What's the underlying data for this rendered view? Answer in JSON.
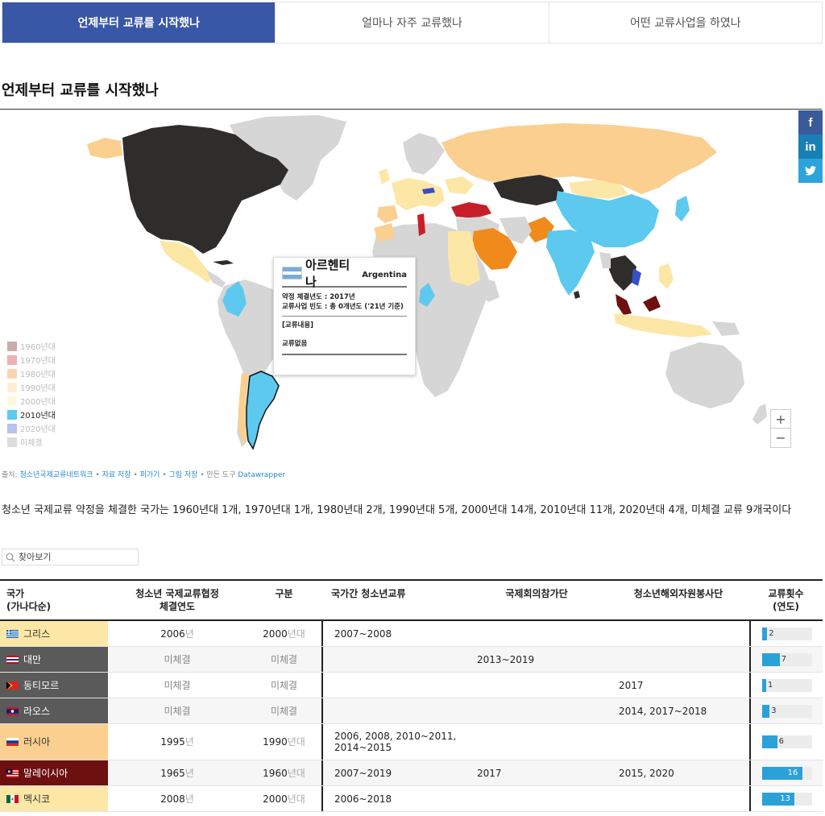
{
  "tabs": [
    {
      "label": "언제부터 교류를 시작했나",
      "active": true
    },
    {
      "label": "얼마나 자주 교류했나",
      "active": false
    },
    {
      "label": "어떤 교류사업을 하였나",
      "active": false
    }
  ],
  "section_title": "언제부터 교류를 시작했나",
  "colors": {
    "tab_active": "#3957a7",
    "decade_1960": "#6e0f10",
    "decade_1970": "#c71f29",
    "decade_1980": "#f08a1b",
    "decade_1990": "#fbcf8f",
    "decade_2000": "#fde7a6",
    "decade_2010": "#5dc9ee",
    "decade_2020": "#3750c4",
    "none": "#d6d6d6",
    "older": "#2e2d2b",
    "bar": "#2aa1d7"
  },
  "legend": [
    {
      "label": "1960년대",
      "color": "#6e0f10",
      "active": false
    },
    {
      "label": "1970년대",
      "color": "#c71f29",
      "active": false
    },
    {
      "label": "1980년대",
      "color": "#f08a1b",
      "active": false
    },
    {
      "label": "1990년대",
      "color": "#fbcf8f",
      "active": false
    },
    {
      "label": "2000년대",
      "color": "#fde7a6",
      "active": false
    },
    {
      "label": "2010년대",
      "color": "#5dc9ee",
      "active": true
    },
    {
      "label": "2020년대",
      "color": "#3750c4",
      "active": false
    },
    {
      "label": "미체결",
      "color": "#d6d6d6",
      "active": false
    }
  ],
  "social": {
    "facebook": "f",
    "linkedin": "in",
    "twitter": "twitter-icon"
  },
  "zoom": {
    "in": "+",
    "out": "−"
  },
  "tooltip": {
    "name_ko": "아르헨티나",
    "name_en": "Argentina",
    "line1": "약정 체결년도 : 2017년",
    "line2": "교류사업 빈도 : 총 0개년도 ('21년 기준)",
    "content_label": "[교류내용]",
    "content_value": "교류없음"
  },
  "credits": {
    "prefix": "출처: ",
    "source": "청소년국제교류네트워크",
    "sep1": " • ",
    "save_data": "자료 저장",
    "sep2": " • ",
    "embed": "퍼가기",
    "sep3": " • ",
    "save_image": "그림 저장",
    "tool_prefix": " • 만든 도구 ",
    "tool": "Datawrapper"
  },
  "summary": "청소년 국제교류 약정을 체결한 국가는 1960년대 1개, 1970년대 1개, 1980년대 2개, 1990년대 5개, 2000년대 14개, 2010년대 11개, 2020년대 4개, 미체결 교류 9개국이다",
  "search": {
    "placeholder": "찾아보기"
  },
  "table": {
    "headers": {
      "country_l1": "국가",
      "country_l2": "(가나다순)",
      "agreement_l1": "청소년 국제교류협정",
      "agreement_l2": "체결연도",
      "category": "구분",
      "bilateral": "국가간 청소년교류",
      "conference": "국제회의참가단",
      "volunteer": "청소년해외자원봉사단",
      "count_l1": "교류횟수",
      "count_l2": "(연도)"
    },
    "rows": [
      {
        "country": "그리스",
        "bg": "#fde7a6",
        "text": "#333",
        "flag": "greece",
        "year": "2006",
        "year_unit": "년",
        "cat": "2000",
        "cat_unit": "년대",
        "bilateral": "2007~2008",
        "conference": "",
        "volunteer": "",
        "count": 2,
        "count_label": "2"
      },
      {
        "country": "대만",
        "bg": "#5a5a5a",
        "text": "#fff",
        "flag": "taiwan",
        "year": "미체결",
        "year_unit": "",
        "cat": "미체결",
        "cat_unit": "",
        "bilateral": "",
        "conference": "2013~2019",
        "volunteer": "",
        "count": 7,
        "count_label": "7"
      },
      {
        "country": "동티모르",
        "bg": "#5a5a5a",
        "text": "#fff",
        "flag": "timor",
        "year": "미체결",
        "year_unit": "",
        "cat": "미체결",
        "cat_unit": "",
        "bilateral": "",
        "conference": "",
        "volunteer": "2017",
        "count": 1,
        "count_label": "1"
      },
      {
        "country": "라오스",
        "bg": "#5a5a5a",
        "text": "#fff",
        "flag": "laos",
        "year": "미체결",
        "year_unit": "",
        "cat": "미체결",
        "cat_unit": "",
        "bilateral": "",
        "conference": "",
        "volunteer": "2014, 2017~2018",
        "count": 3,
        "count_label": "3"
      },
      {
        "country": "러시아",
        "bg": "#fbcf8f",
        "text": "#333",
        "flag": "russia",
        "year": "1995",
        "year_unit": "년",
        "cat": "1990",
        "cat_unit": "년대",
        "bilateral": "2006, 2008, 2010~2011, 2014~2015",
        "conference": "",
        "volunteer": "",
        "count": 6,
        "count_label": "6"
      },
      {
        "country": "말레이시아",
        "bg": "#6e0f10",
        "text": "#fff",
        "flag": "malaysia",
        "year": "1965",
        "year_unit": "년",
        "cat": "1960",
        "cat_unit": "년대",
        "bilateral": "2007~2019",
        "conference": "2017",
        "volunteer": "2015, 2020",
        "count": 16,
        "count_label": "16"
      },
      {
        "country": "멕시코",
        "bg": "#fde7a6",
        "text": "#333",
        "flag": "mexico",
        "year": "2008",
        "year_unit": "년",
        "cat": "2000",
        "cat_unit": "년대",
        "bilateral": "2006~2018",
        "conference": "",
        "volunteer": "",
        "count": 13,
        "count_label": "13"
      }
    ]
  }
}
